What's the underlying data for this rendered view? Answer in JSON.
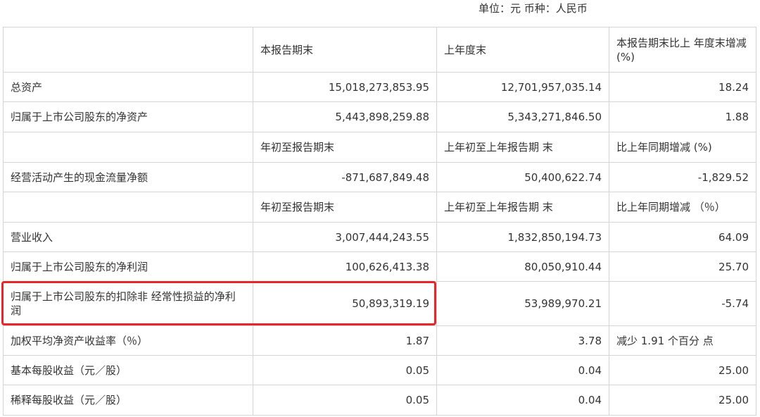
{
  "caption": "单位：元 币种：人民币",
  "header": {
    "c1": "本报告期末",
    "c2": "上年度末",
    "c3": "本报告期末比上 年度末增减 (%)"
  },
  "rows": [
    {
      "label": "总资产",
      "v1": "15,018,273,853.95",
      "v2": "12,701,957,035.14",
      "v3": "18.24"
    },
    {
      "label": "归属于上市公司股东的净资产",
      "v1": "5,443,898,259.88",
      "v2": "5,343,271,846.50",
      "v3": "1.88"
    }
  ],
  "subheader1": {
    "c1": "年初至报告期末",
    "c2": "上年初至上年报告期 末",
    "c3": "比上年同期增减 (%)"
  },
  "cashflow": {
    "label": "经营活动产生的现金流量净额",
    "v1": "-871,687,849.48",
    "v2": "50,400,622.74",
    "v3": "-1,829.52"
  },
  "subheader2": {
    "c1": "年初至报告期末",
    "c2": "上年初至上年报告期 末",
    "c3": "比上年同期增减 （％）"
  },
  "rows2": [
    {
      "label": "营业收入",
      "v1": "3,007,444,243.55",
      "v2": "1,832,850,194.73",
      "v3": "64.09"
    },
    {
      "label": "归属于上市公司股东的净利润",
      "v1": "100,626,413.38",
      "v2": "80,050,910.44",
      "v3": "25.70"
    },
    {
      "label": "归属于上市公司股东的扣除非 经常性损益的净利润",
      "v1": "50,893,319.19",
      "v2": "53,989,970.21",
      "v3": "-5.74"
    },
    {
      "label": "加权平均净资产收益率（％）",
      "v1": "1.87",
      "v2": "3.78",
      "v3": "减少 1.91 个百分 点"
    },
    {
      "label": "基本每股收益（元／股）",
      "v1": "0.05",
      "v2": "0.04",
      "v3": "25.00"
    },
    {
      "label": "稀释每股收益（元／股）",
      "v1": "0.05",
      "v2": "0.04",
      "v3": "25.00"
    }
  ],
  "colors": {
    "highlight_border": "#e8262a",
    "grid_line": "#d4d4d4",
    "text": "#333333"
  }
}
